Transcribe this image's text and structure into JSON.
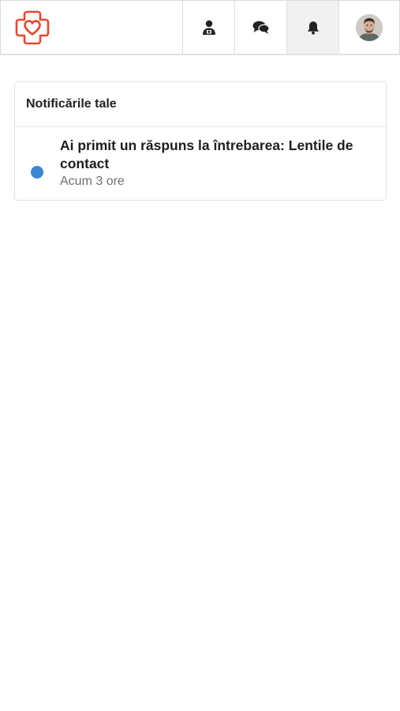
{
  "header": {
    "logo": "heart-cross-logo",
    "nav": [
      {
        "icon": "doctor-icon",
        "active": false
      },
      {
        "icon": "chat-icon",
        "active": false
      },
      {
        "icon": "bell-icon",
        "active": true
      },
      {
        "icon": "user-avatar",
        "active": false
      }
    ]
  },
  "notifications": {
    "title": "Notificările tale",
    "items": [
      {
        "title": "Ai primit un răspuns la întrebarea: Lentile de contact",
        "time": "Acum 3 ore",
        "unread_color": "#3a86d4"
      }
    ]
  },
  "colors": {
    "brand": "#e8472b",
    "unread": "#3a86d4"
  }
}
